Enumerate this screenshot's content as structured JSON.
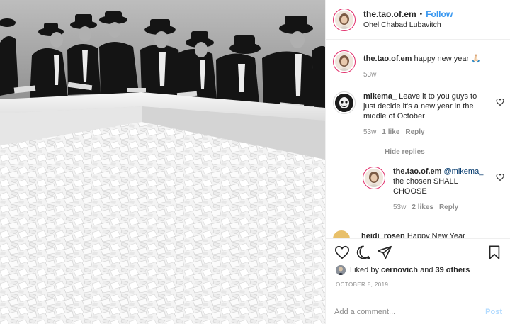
{
  "header": {
    "username": "the.tao.of.em",
    "separator": "•",
    "follow_label": "Follow",
    "location": "Ohel Chabad Lubavitch"
  },
  "caption": {
    "author": "the.tao.of.em",
    "text": "happy new year 🙏🏻",
    "age": "53w"
  },
  "comments": [
    {
      "author": "mikema_",
      "text": "Leave it to you guys to just decide it's a new year in the middle of October",
      "age": "53w",
      "likes": "1 like",
      "reply_label": "Reply"
    }
  ],
  "hide_replies_label": "Hide replies",
  "reply": {
    "author": "the.tao.of.em",
    "mention": "@mikema_",
    "text": "the chosen SHALL CHOOSE",
    "age": "53w",
    "likes": "2 likes",
    "reply_label": "Reply"
  },
  "peek_comment": {
    "author": "heidi_rosen",
    "text": "Happy New Year"
  },
  "likes": {
    "prefix": "Liked by",
    "user": "cernovich",
    "joiner": "and",
    "others": "39 others"
  },
  "post_date": "OCTOBER 8, 2019",
  "add_comment": {
    "placeholder": "Add a comment...",
    "post_label": "Post"
  },
  "icons": {
    "like": "heart-icon",
    "comment": "comment-bubble-icon",
    "share": "paper-plane-icon",
    "save": "bookmark-icon",
    "comment_like": "small-heart-icon"
  },
  "colors": {
    "follow": "#3897f0",
    "post_disabled": "#b3dbff",
    "muted": "#8e8e8e",
    "story_ring": "#e1306c"
  }
}
